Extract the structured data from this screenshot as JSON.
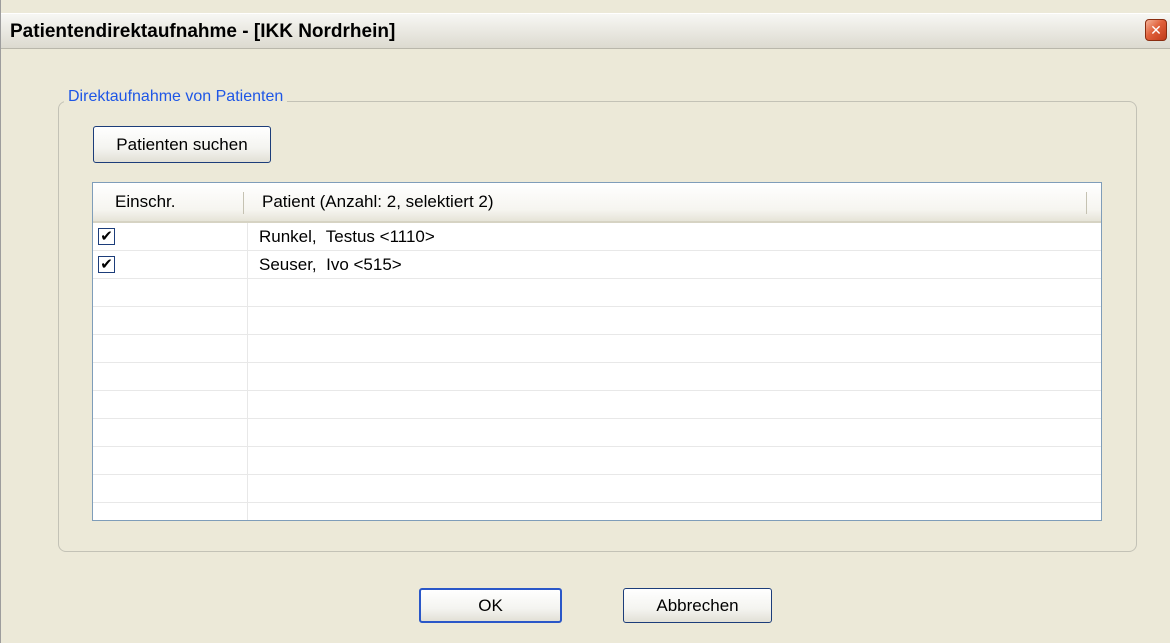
{
  "window": {
    "title": "Patientendirektaufnahme - [IKK Nordrhein]",
    "close_glyph": "✕"
  },
  "group": {
    "legend": "Direktaufnahme von Patienten",
    "search_button": "Patienten suchen"
  },
  "table": {
    "columns": [
      "Einschr.",
      "Patient (Anzahl: 2, selektiert 2)"
    ],
    "rows": [
      {
        "checked": true,
        "check_glyph": "✔",
        "patient": "Runkel,  Testus <1110>"
      },
      {
        "checked": true,
        "check_glyph": "✔",
        "patient": "Seuser,  Ivo <515>"
      }
    ]
  },
  "footer": {
    "ok_label": "OK",
    "cancel_label": "Abbrechen"
  }
}
